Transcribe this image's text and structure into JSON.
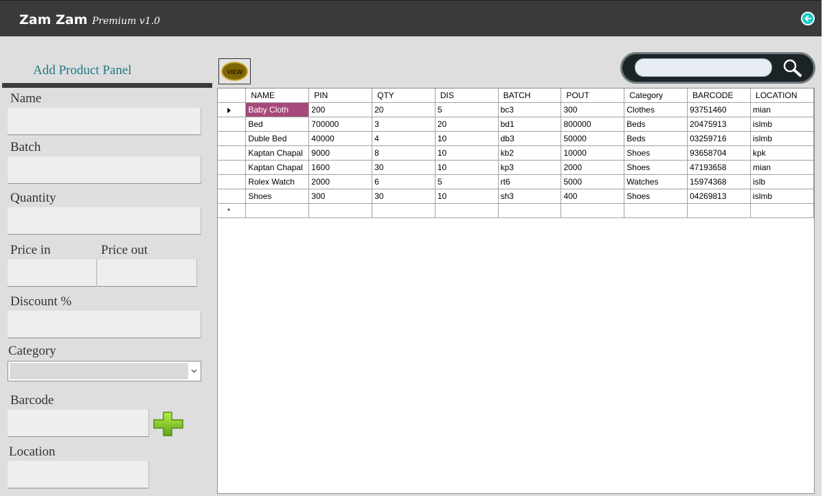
{
  "header": {
    "title": "Zam Zam",
    "subtitle": "Premium v1.0",
    "back_icon": "back-arrow-icon"
  },
  "panel": {
    "title": "Add Product Panel",
    "labels": {
      "name": "Name",
      "batch": "Batch",
      "quantity": "Quantity",
      "price_in": "Price in",
      "price_out": "Price out",
      "discount": "Discount %",
      "category": "Category",
      "barcode": "Barcode",
      "location": "Location"
    },
    "values": {
      "name": "",
      "batch": "",
      "quantity": "",
      "price_in": "",
      "price_out": "",
      "discount": "",
      "category": "",
      "barcode": "",
      "location": ""
    }
  },
  "toolbar": {
    "view_label": "VIEW",
    "search_value": "",
    "search_icon": "magnifier-icon",
    "add_icon": "green-plus-icon"
  },
  "table": {
    "columns": [
      "NAME",
      "PIN",
      "QTY",
      "DIS",
      "BATCH",
      "POUT",
      "Category",
      "BARCODE",
      "LOCATION"
    ],
    "rows": [
      [
        "Baby Cloth",
        "200",
        "20",
        "5",
        "bc3",
        "300",
        "Clothes",
        "93751460",
        "mian"
      ],
      [
        "Bed",
        "700000",
        "3",
        "20",
        "bd1",
        "800000",
        "Beds",
        "20475913",
        "islmb"
      ],
      [
        "Duble Bed",
        "40000",
        "4",
        "10",
        "db3",
        "50000",
        "Beds",
        "03259716",
        "islmb"
      ],
      [
        "Kaptan Chapal",
        "9000",
        "8",
        "10",
        "kb2",
        "10000",
        "Shoes",
        "93658704",
        "kpk"
      ],
      [
        "Kaptan Chapal",
        "1600",
        "30",
        "10",
        "kp3",
        "2000",
        "Shoes",
        "47193658",
        "mian"
      ],
      [
        "Rolex Watch",
        "2000",
        "6",
        "5",
        "rt6",
        "5000",
        "Watches",
        "15974368",
        "islb"
      ],
      [
        "Shoes",
        "300",
        "30",
        "10",
        "sh3",
        "400",
        "Shoes",
        "04269813",
        "islmb"
      ]
    ],
    "new_row_marker": "*"
  },
  "colors": {
    "titlebar": "#3a3a3a",
    "panel_title": "#1e7a86",
    "selected_cell": "#a7487a",
    "back_button": "#1ec6c6"
  }
}
